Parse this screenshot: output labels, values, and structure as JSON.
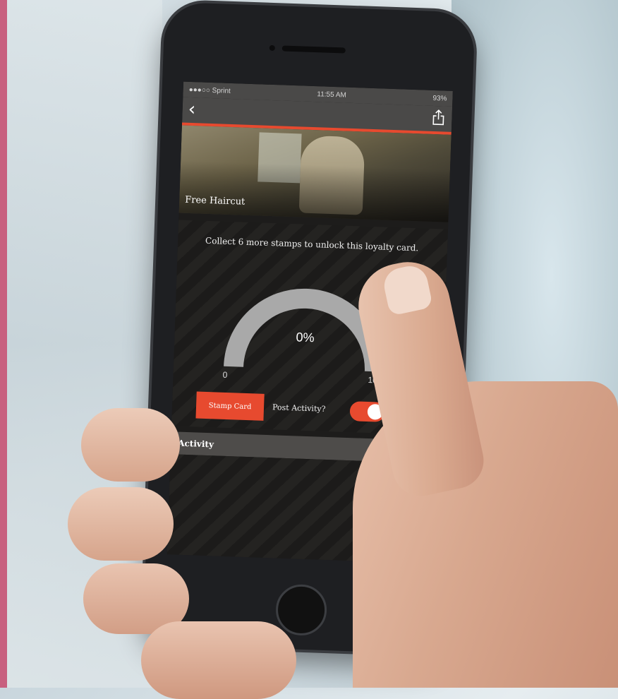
{
  "status_bar": {
    "carrier": "●●●○○ Sprint",
    "time": "11:55 AM",
    "battery": "93%"
  },
  "nav": {
    "back_icon": "chevron-left-icon",
    "share_icon": "share-icon"
  },
  "hero": {
    "title": "Free Haircut"
  },
  "card": {
    "message": "Collect 6 more stamps to unlock this loyalty card.",
    "gauge": {
      "value_label": "0%",
      "progress_percent": 0,
      "min_label": "0",
      "max_label": "100"
    },
    "stamp_button_label": "Stamp Card",
    "post_activity_label": "Post Activity?",
    "post_activity_enabled": true
  },
  "activity": {
    "title": "Activity",
    "icon": "info-circle-icon"
  },
  "colors": {
    "accent": "#e74a2f",
    "bar": "#4a4948",
    "gauge_track": "#a9a9a9",
    "page_edge": "#c8607f"
  }
}
